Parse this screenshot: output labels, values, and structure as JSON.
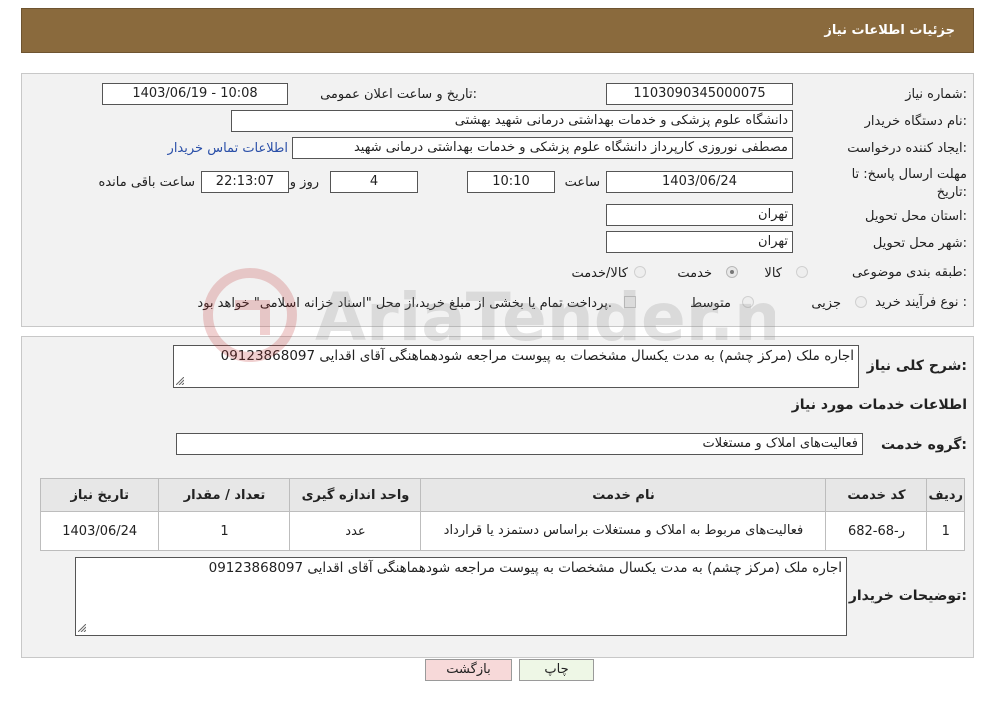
{
  "header": {
    "title": "جزئیات اطلاعات نیاز"
  },
  "fields": {
    "need_number_label": "شماره نیاز:",
    "need_number": "1103090345000075",
    "announce_label": "تاریخ و ساعت اعلان عمومی:",
    "announce_value": "1403/06/19 - 10:08",
    "buyer_org_label": "نام دستگاه خریدار:",
    "buyer_org": "دانشگاه علوم پزشکی و خدمات بهداشتی درمانی شهید بهشتی",
    "creator_label": "ایجاد کننده درخواست:",
    "creator": "مصطفی نوروزی کارپرداز دانشگاه علوم پزشکی و خدمات بهداشتی درمانی شهید",
    "contact_link": "اطلاعات تماس خریدار",
    "deadline_label_1": "مهلت ارسال پاسخ: تا",
    "deadline_label_2": "تاریخ:",
    "deadline_date": "1403/06/24",
    "time_label": "ساعت",
    "deadline_time": "10:10",
    "days_value": "4",
    "days_label": "روز و",
    "remaining_time": "22:13:07",
    "remaining_label": "ساعت باقی مانده",
    "province_label": "استان محل تحویل:",
    "province": "تهران",
    "city_label": "شهر محل تحویل:",
    "city": "تهران",
    "category_label": "طبقه بندی موضوعی:",
    "category_options": [
      "کالا",
      "خدمت",
      "کالا/خدمت"
    ],
    "process_label": "نوع فرآیند خرید :",
    "process_options": [
      "جزیی",
      "متوسط"
    ],
    "payment_note": "پرداخت تمام یا بخشی از مبلغ خرید،از محل \"اسناد خزانه اسلامی\" خواهد بود."
  },
  "description": {
    "label": "شرح کلی نیاز:",
    "text": "اجاره ملک (مرکز چشم) به مدت یکسال مشخصات به پیوست مراجعه شودهماهنگی آقای اقدایی 09123868097"
  },
  "services": {
    "section_title": "اطلاعات خدمات مورد نیاز",
    "group_label": "گروه خدمت:",
    "group_value": "فعالیت‌های  املاک و مستغلات",
    "table": {
      "headers": [
        "ردیف",
        "کد خدمت",
        "نام خدمت",
        "واحد اندازه گیری",
        "تعداد / مقدار",
        "تاریخ نیاز"
      ],
      "rows": [
        [
          "1",
          "ر-68-682",
          "فعالیت‌های مربوط به املاک و مستغلات براساس دستمزد یا قرارداد",
          "عدد",
          "1",
          "1403/06/24"
        ]
      ]
    }
  },
  "buyer_notes": {
    "label": "توضیحات خریدار:",
    "text": "اجاره ملک (مرکز چشم) به مدت یکسال مشخصات به پیوست مراجعه شودهماهنگی آقای اقدایی 09123868097"
  },
  "buttons": {
    "print": "چاپ",
    "back": "بازگشت"
  },
  "watermark": "AriaTender.neT",
  "colors": {
    "header_bg": "#8a6a3d",
    "back_button_bg": "#f7d9d9",
    "print_button_bg": "#eef7e6",
    "link": "#2a4fa8"
  }
}
